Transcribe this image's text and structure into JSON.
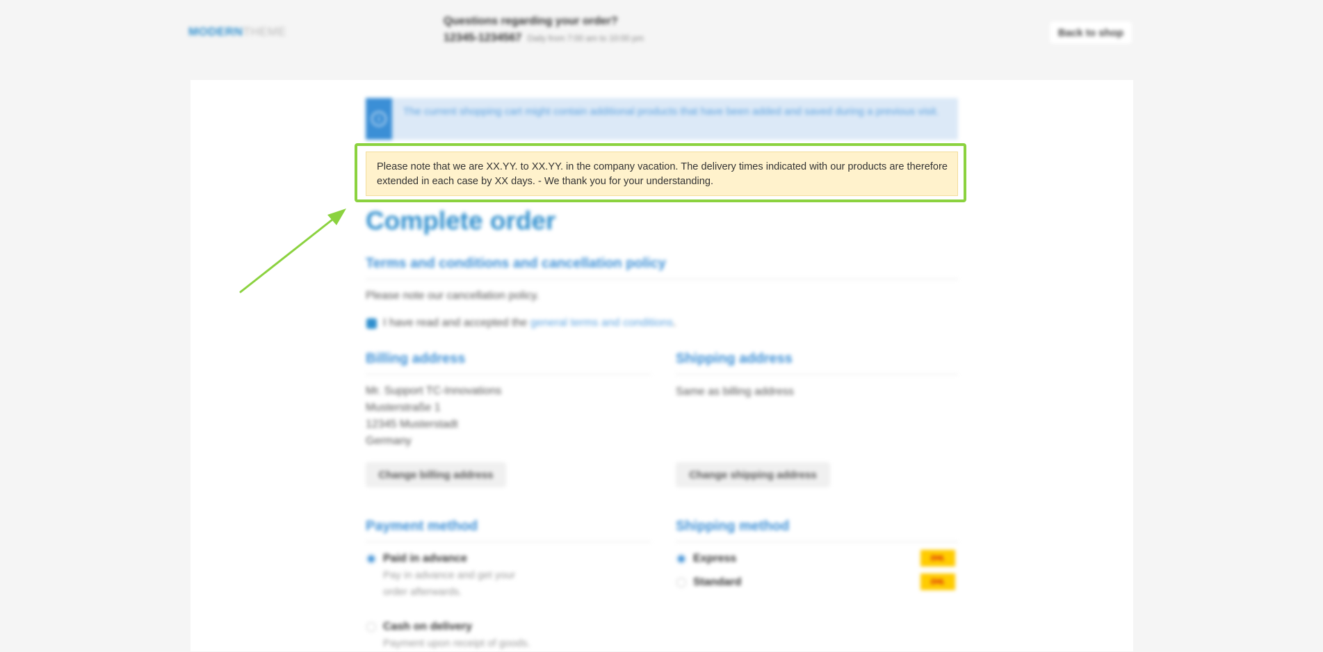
{
  "header": {
    "logo_part1": "MODERN",
    "logo_part2": "THEME",
    "question": "Questions regarding your order?",
    "phone": "12345-1234567",
    "hours": "Daily from 7:00 am to 10:00 pm",
    "back_to_shop": "Back to shop"
  },
  "info_alert": {
    "text": "The current shopping cart might contain additional products that have been added and saved during a previous visit.",
    "icon": "info-icon"
  },
  "notice": {
    "text": "Please note that we are XX.YY. to XX.YY. in the company vacation. The delivery times indicated with our products are therefore extended in each case by XX days. - We thank you for your understanding."
  },
  "page_title": "Complete order",
  "terms": {
    "heading": "Terms and conditions and cancellation policy",
    "cancellation_link": "Please note our cancellation policy.",
    "accept_prefix": "I have read and accepted the",
    "accept_link": "general terms and conditions",
    "accept_suffix": ".",
    "accepted": true
  },
  "billing": {
    "heading": "Billing address",
    "lines": [
      "Mr. Support TC-Innovations",
      "Musterstraße 1",
      "12345 Musterstadt",
      "Germany"
    ],
    "change_button": "Change billing address"
  },
  "shipping": {
    "heading": "Shipping address",
    "text": "Same as billing address",
    "change_button": "Change shipping address"
  },
  "payment": {
    "heading": "Payment method",
    "options": [
      {
        "label": "Paid in advance",
        "description_line1": "Pay in advance and get your",
        "description_line2": "order afterwards.",
        "selected": true
      },
      {
        "label": "Cash on delivery",
        "description_line1": "Payment upon receipt of goods.",
        "selected": false
      }
    ]
  },
  "shipping_method": {
    "heading": "Shipping method",
    "options": [
      {
        "label": "Express",
        "carrier_logo": "DHL",
        "selected": true
      },
      {
        "label": "Standard",
        "carrier_logo": "DHL",
        "selected": false
      }
    ]
  },
  "colors": {
    "accent": "#2f8fce",
    "highlight": "#8bd23f",
    "notice_bg": "#fff2cc"
  }
}
